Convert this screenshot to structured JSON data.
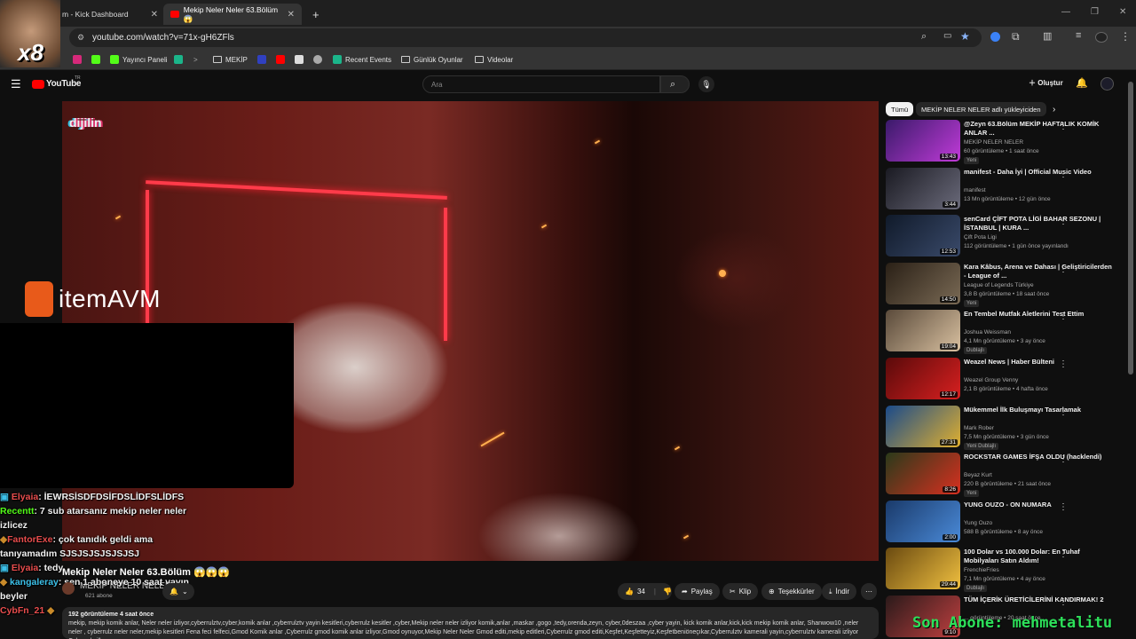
{
  "browser": {
    "tabs": [
      {
        "label": "m - Kick Dashboard",
        "active": false
      },
      {
        "label": "Mekip Neler Neler 63.Bölüm 😱",
        "active": true
      }
    ],
    "new_tab": "+",
    "url": "youtube.com/watch?v=71x-gH6ZFls",
    "bookmarks": [
      "Yayıncı Paneli",
      "MEKİP",
      "Recent Events",
      "Günlük Oyunlar",
      "Videolar"
    ]
  },
  "overlay": {
    "cam_label": "x8",
    "sponsor_prefix": "item",
    "sponsor_suffix": "AVM",
    "watermark": "dijilin",
    "sub_banner": "Son Abone: mehmetalitu"
  },
  "chat": [
    {
      "user": "Elyaia",
      "msg": ": İEWRSİSDFDSİFDSLİDFSLİDFS"
    },
    {
      "user": "Recentt",
      "msg": ": 7 sub atarsanız mekip neler neler izlicez"
    },
    {
      "user": "FantorExe",
      "msg": ": çok tanıdık geldi ama tanıyamadım SJSJSJSJSJSJSJ"
    },
    {
      "user": "Elyaia",
      "msg": ": tedy"
    },
    {
      "user": "kangaleray",
      "msg": ": sen 1 aboneye 10 saat yayın beyler"
    },
    {
      "user": "CybFn_21",
      "msg": ""
    }
  ],
  "youtube": {
    "logo": "YouTube",
    "logo_sup": "TR",
    "search_placeholder": "Ara",
    "create_label": "Oluştur",
    "video_title": "Mekip Neler Neler 63.Bölüm 😱😱😱",
    "channel": "MEKİP NELER NELER",
    "subs": "621 abone",
    "likes": "34",
    "share": "Paylaş",
    "clip": "Klip",
    "thanks": "Teşekkürler",
    "download": "İndir",
    "desc_views": "192 görüntüleme  4 saat önce",
    "desc_text": "mekip, mekip komik anlar, Neler neler izliyor,cyberrulztv,cyber,komik anlar ,cyberrulztv yayin kesitleri,cyberrulz kesitler ,cyber,Mekip neler neler izliyor komik,anlar ,maskar ,gogo ,tedy,orenda,zeyn, cyber,0deszaa ,cyber yayin, kick komik anlar,kick,kick mekip komik anlar, Shanwow10 ,neler neler , cyberrulz neler neler,mekip kesitleri Fena feci felfeci,Gmod Komik anlar ,Cyberrulz gmod komik anlar izliyor,Gmod oynuyor,Mekip Neler Neler Gmod editi,mekip editleri,Cyberrulz gmod editi,Keşfet,Keşfetteyiz,Keşfetbeniöneçıkar,Cyberrulztv kamerali yayin,cyberrulztv kamerali izliyor Cyberrulz ilk"
  },
  "sidebar": {
    "chips": [
      "Tümü",
      "MEKİP NELER NELER adlı yükleyiciden"
    ],
    "recs": [
      {
        "title": "@Zeyn 63.Bölüm MEKİP HAFTALIK KOMİK ANLAR ...",
        "channel": "MEKİP NELER NELER",
        "meta": "60 görüntüleme • 1 saat önce",
        "badge": "Yeni",
        "dur": "13:43",
        "c1": "#3a1a6a",
        "c2": "#c03bd8"
      },
      {
        "title": "manifest - Daha İyi | Official Music Video",
        "channel": "manifest",
        "meta": "13 Mn görüntüleme • 12 gün önce",
        "badge": "",
        "dur": "3:44",
        "c1": "#1a1a22",
        "c2": "#6a6a7a"
      },
      {
        "title": "senCard ÇİFT POTA LİGİ BAHAR SEZONU | İSTANBUL | KURA ...",
        "channel": "Çift Pota Ligi",
        "meta": "112 görüntüleme • 1 gün önce yayınlandı",
        "badge": "",
        "dur": "12:53",
        "c1": "#101a2a",
        "c2": "#3a4a6a"
      },
      {
        "title": "Kara Kâbus, Arena ve Dahası | Geliştiricilerden - League of ...",
        "channel": "League of Legends Türkiye",
        "meta": "3,8 B görüntüleme • 18 saat önce",
        "badge": "Yeni",
        "dur": "14:50",
        "c1": "#2a2016",
        "c2": "#7a6a55"
      },
      {
        "title": "En Tembel Mutfak Aletlerini Test Ettim",
        "channel": "Joshua Weissman",
        "meta": "4,1 Mn görüntüleme • 3 ay önce",
        "badge": "Dublajlı",
        "dur": "19:04",
        "c1": "#5a4a3a",
        "c2": "#d8c0a0"
      },
      {
        "title": "Weazel News | Haber Bülteni",
        "channel": "Weazel Group Venny",
        "meta": "2,1 B görüntüleme • 4 hafta önce",
        "badge": "",
        "dur": "12:17",
        "c1": "#5a0a0a",
        "c2": "#d82020"
      },
      {
        "title": "Mükemmel İlk Buluşmayı Tasarlamak",
        "channel": "Mark Rober",
        "meta": "7,5 Mn görüntüleme • 3 gün önce",
        "badge": "Yeni  Dublajlı",
        "dur": "27:31",
        "c1": "#1a4a8a",
        "c2": "#e0b030"
      },
      {
        "title": "ROCKSTAR GAMES İFŞA OLDU (hacklendi)",
        "channel": "Beyaz Kurt",
        "meta": "220 B görüntüleme • 21 saat önce",
        "badge": "Yeni",
        "dur": "8:26",
        "c1": "#2a3a1a",
        "c2": "#d83020"
      },
      {
        "title": "YUNG OUZO - ON NUMARA",
        "channel": "Yung Ouzo",
        "meta": "588 B görüntüleme • 8 ay önce",
        "badge": "",
        "dur": "2:00",
        "c1": "#1a3a6a",
        "c2": "#4a8ad8"
      },
      {
        "title": "100 Dolar vs 100.000 Dolar: En Tuhaf Mobilyaları Satın Aldım!",
        "channel": "FrenchieFries",
        "meta": "7,1 Mn görüntüleme • 4 ay önce",
        "badge": "Dublajlı",
        "dur": "29:44",
        "c1": "#6a4a10",
        "c2": "#f0c040"
      },
      {
        "title": "TÜM İÇERİK ÜRETİCİLERİNİ KANDIRMAK! 2",
        "channel": "",
        "meta": "... görüntüleme • 20 saat önce",
        "badge": "",
        "dur": "9:10",
        "c1": "#2a1a1a",
        "c2": "#c04040"
      }
    ]
  }
}
